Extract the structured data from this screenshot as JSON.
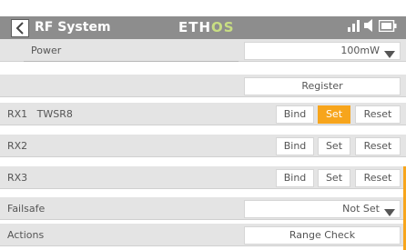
{
  "header": {
    "title": "RF System",
    "logo_prefix": "ETH",
    "logo_suffix": "OS",
    "accent_color": "#f7a51c",
    "icons": [
      "back-icon",
      "signal-icon",
      "speaker-icon",
      "battery-icon"
    ]
  },
  "rows": {
    "power": {
      "label": "Power",
      "value": "100mW"
    },
    "register": {
      "label": "Register"
    },
    "rx1": {
      "label": "RX1   TWSR8",
      "bind": "Bind",
      "set": "Set",
      "reset": "Reset"
    },
    "rx2": {
      "label": "RX2",
      "bind": "Bind",
      "set": "Set",
      "reset": "Reset"
    },
    "rx3": {
      "label": "RX3",
      "bind": "Bind",
      "set": "Set",
      "reset": "Reset"
    },
    "failsafe": {
      "label": "Failsafe",
      "value": "Not Set"
    },
    "actions": {
      "label": "Actions",
      "range_check": "Range Check"
    }
  }
}
